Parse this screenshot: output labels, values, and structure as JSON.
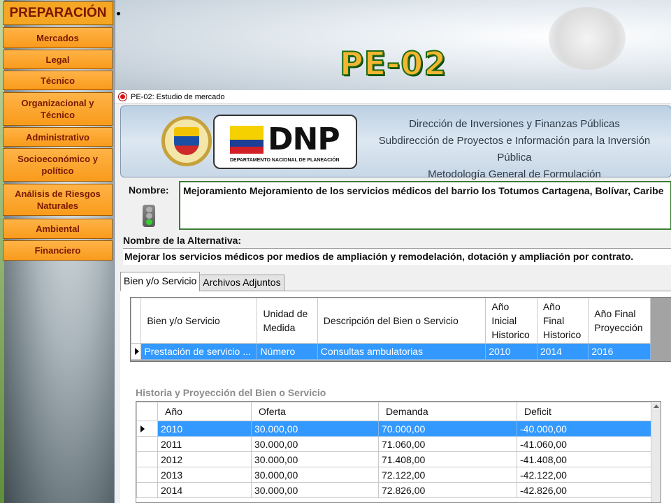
{
  "side_menu": {
    "title": "PREPARACIÓN",
    "items": [
      {
        "label": "Mercados"
      },
      {
        "label": "Legal"
      },
      {
        "label": "Técnico"
      },
      {
        "label": "Organizacional y Técnico"
      },
      {
        "label": "Administrativo"
      },
      {
        "label": "Socioeconómico y político"
      },
      {
        "label": "Análisis de Riesgos Naturales"
      },
      {
        "label": "Ambiental"
      },
      {
        "label": "Financiero"
      }
    ]
  },
  "page_title": "PE-02",
  "window": {
    "title": "PE-02: Estudio de mercado",
    "banner": {
      "logo_text": "DNP",
      "logo_subtitle": "DEPARTAMENTO NACIONAL DE PLANEACIÓN",
      "line1": "Dirección de Inversiones y Finanzas Públicas",
      "line2": "Subdirección de Proyectos e Información para la Inversión Pública",
      "line3": "Metodología General de Formulación"
    },
    "nombre_label": "Nombre:",
    "nombre_value": "Mejoramiento Mejoramiento de los servicios médicos del barrio los Totumos Cartagena, Bolívar, Caribe",
    "alternativa_label": "Nombre de la Alternativa:",
    "alternativa_value": "Mejorar los servicios médicos por medios de ampliación y remodelación, dotación y ampliación por contrato.",
    "tabs": [
      {
        "label": "Bien y/o Servicio",
        "active": true
      },
      {
        "label": "Archivos Adjuntos",
        "active": false
      }
    ],
    "bien_grid": {
      "headers": [
        "Bien y/o Servicio",
        "Unidad de Medida",
        "Descripción del Bien o Servicio",
        "Año Inicial Historico",
        "Año Final Historico",
        "Año Final Proyección"
      ],
      "rows": [
        [
          "Prestación de servicio ...",
          "Número",
          "Consultas ambulatorias",
          "2010",
          "2014",
          "2016"
        ]
      ]
    },
    "historia_title": "Historia y Proyección del Bien o Servicio",
    "historia_grid": {
      "headers": [
        "Año",
        "Oferta",
        "Demanda",
        "Deficit"
      ],
      "rows": [
        [
          "2010",
          "30.000,00",
          "70.000,00",
          "-40.000,00"
        ],
        [
          "2011",
          "30.000,00",
          "71.060,00",
          "-41.060,00"
        ],
        [
          "2012",
          "30.000,00",
          "71.408,00",
          "-41.408,00"
        ],
        [
          "2013",
          "30.000,00",
          "72.122,00",
          "-42.122,00"
        ],
        [
          "2014",
          "30.000,00",
          "72.826,00",
          "-42.826,00"
        ]
      ]
    }
  }
}
